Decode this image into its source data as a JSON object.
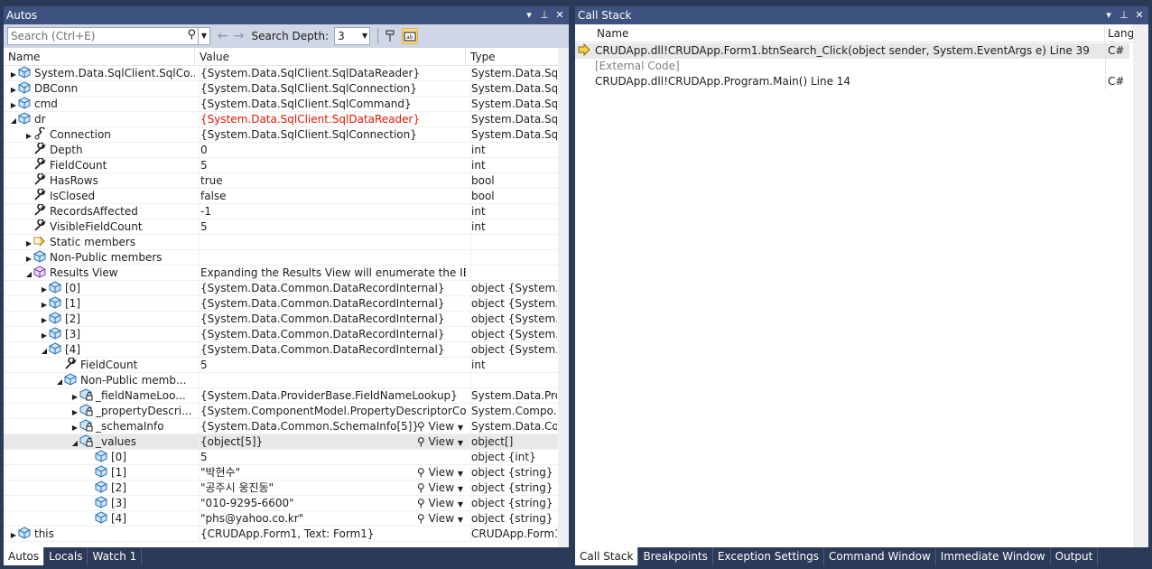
{
  "autos": {
    "title": "Autos",
    "search_placeholder": "Search (Ctrl+E)",
    "search_depth_label": "Search Depth:",
    "search_depth_value": "3",
    "columns": {
      "name": "Name",
      "value": "Value",
      "type": "Type"
    },
    "view_label": "View",
    "rows": [
      {
        "name": "System.Data.SqlClient.SqlCo...",
        "value": "{System.Data.SqlClient.SqlDataReader}",
        "type": "System.Data.Sql..."
      },
      {
        "name": "DBConn",
        "value": "{System.Data.SqlClient.SqlConnection}",
        "type": "System.Data.Sql..."
      },
      {
        "name": "cmd",
        "value": "{System.Data.SqlClient.SqlCommand}",
        "type": "System.Data.Sql..."
      },
      {
        "name": "dr",
        "value": "{System.Data.SqlClient.SqlDataReader}",
        "type": "System.Data.Sql..."
      },
      {
        "name": "Connection",
        "value": "{System.Data.SqlClient.SqlConnection}",
        "type": "System.Data.Sql..."
      },
      {
        "name": "Depth",
        "value": "0",
        "type": "int"
      },
      {
        "name": "FieldCount",
        "value": "5",
        "type": "int"
      },
      {
        "name": "HasRows",
        "value": "true",
        "type": "bool"
      },
      {
        "name": "IsClosed",
        "value": "false",
        "type": "bool"
      },
      {
        "name": "RecordsAffected",
        "value": "-1",
        "type": "int"
      },
      {
        "name": "VisibleFieldCount",
        "value": "5",
        "type": "int"
      },
      {
        "name": "Static members",
        "value": "",
        "type": ""
      },
      {
        "name": "Non-Public members",
        "value": "",
        "type": ""
      },
      {
        "name": "Results View",
        "value": "Expanding the Results View will enumerate the IEnum...",
        "type": ""
      },
      {
        "name": "[0]",
        "value": "{System.Data.Common.DataRecordInternal}",
        "type": "object {System...."
      },
      {
        "name": "[1]",
        "value": "{System.Data.Common.DataRecordInternal}",
        "type": "object {System...."
      },
      {
        "name": "[2]",
        "value": "{System.Data.Common.DataRecordInternal}",
        "type": "object {System...."
      },
      {
        "name": "[3]",
        "value": "{System.Data.Common.DataRecordInternal}",
        "type": "object {System...."
      },
      {
        "name": "[4]",
        "value": "{System.Data.Common.DataRecordInternal}",
        "type": "object {System...."
      },
      {
        "name": "FieldCount",
        "value": "5",
        "type": "int"
      },
      {
        "name": "Non-Public memb...",
        "value": "",
        "type": ""
      },
      {
        "name": "_fieldNameLoo...",
        "value": "{System.Data.ProviderBase.FieldNameLookup}",
        "type": "System.Data.Pro..."
      },
      {
        "name": "_propertyDescri...",
        "value": "{System.ComponentModel.PropertyDescriptorCollecti...",
        "type": "System.Compo..."
      },
      {
        "name": "_schemaInfo",
        "value": "{System.Data.Common.SchemaInfo[5]}",
        "type": "System.Data.Co..."
      },
      {
        "name": "_values",
        "value": "{object[5]}",
        "type": "object[]"
      },
      {
        "name": "[0]",
        "value": "5",
        "type": "object {int}"
      },
      {
        "name": "[1]",
        "value": "\"박현수\"",
        "type": "object {string}"
      },
      {
        "name": "[2]",
        "value": "\"공주시 웅진동\"",
        "type": "object {string}"
      },
      {
        "name": "[3]",
        "value": "\"010-9295-6600\"",
        "type": "object {string}"
      },
      {
        "name": "[4]",
        "value": "\"phs@yahoo.co.kr\"",
        "type": "object {string}"
      },
      {
        "name": "this",
        "value": "{CRUDApp.Form1, Text: Form1}",
        "type": "CRUDApp.Form1"
      }
    ],
    "tabs": [
      "Autos",
      "Locals",
      "Watch 1"
    ]
  },
  "callstack": {
    "title": "Call Stack",
    "columns": {
      "name": "Name",
      "lang": "Lang"
    },
    "rows": [
      {
        "name": "CRUDApp.dll!CRUDApp.Form1.btnSearch_Click(object sender, System.EventArgs e) Line 39",
        "lang": "C#"
      },
      {
        "name": "[External Code]",
        "lang": ""
      },
      {
        "name": "CRUDApp.dll!CRUDApp.Program.Main() Line 14",
        "lang": "C#"
      }
    ],
    "tabs": [
      "Call Stack",
      "Breakpoints",
      "Exception Settings",
      "Command Window",
      "Immediate Window",
      "Output"
    ]
  },
  "colors": {
    "title_bar": "#3e5280",
    "background": "#2b3a57",
    "error_value": "#e51400"
  }
}
